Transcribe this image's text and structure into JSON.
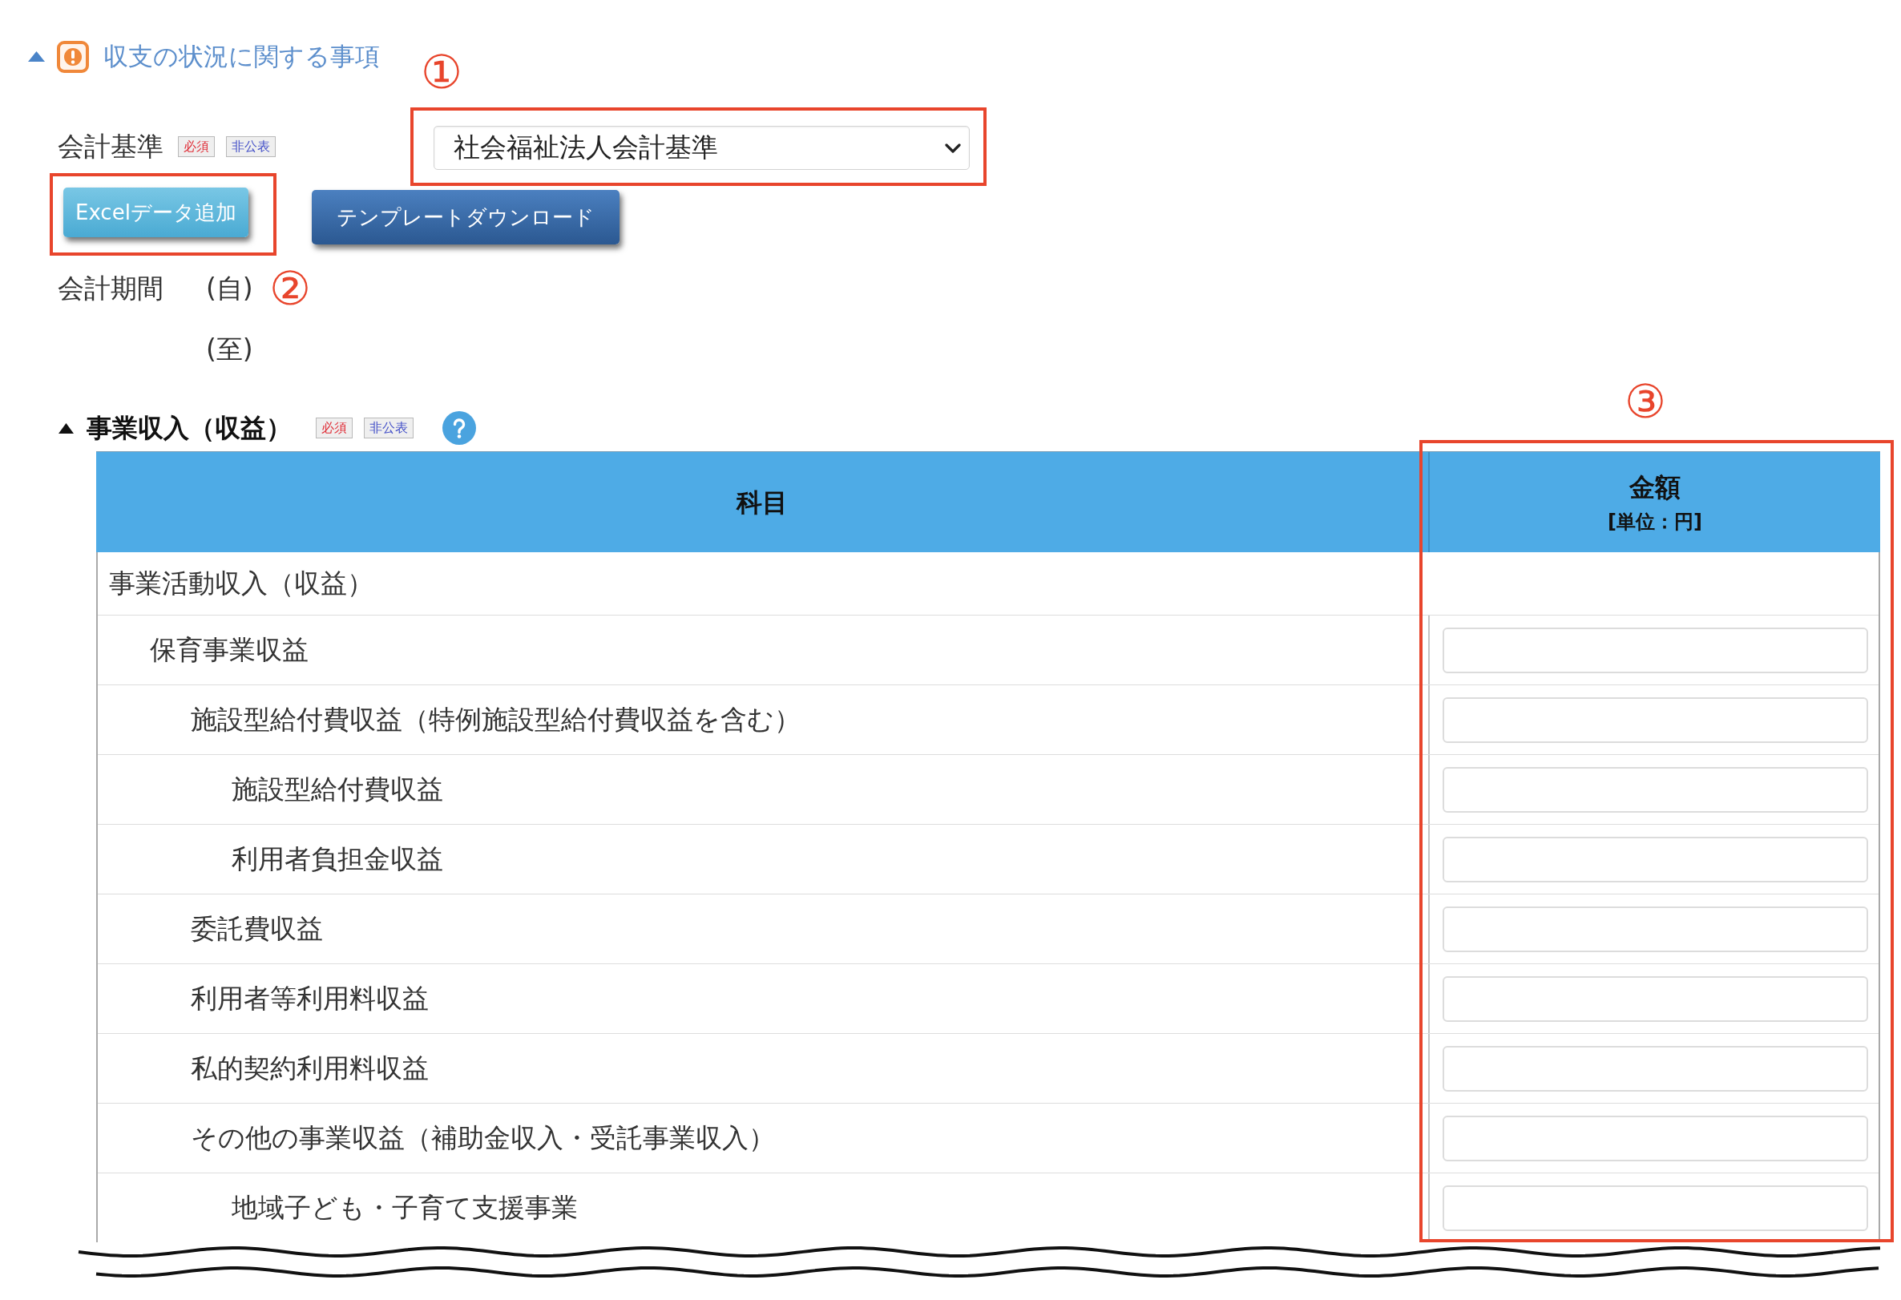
{
  "section": {
    "title": "収支の状況に関する事項",
    "expanded": true
  },
  "accounting_standard": {
    "label": "会計基準",
    "badges": [
      {
        "label": "必須",
        "kind": "required"
      },
      {
        "label": "非公表",
        "kind": "private"
      }
    ],
    "value": "社会福祉法人会計基準",
    "callout": "①"
  },
  "buttons": [
    {
      "label": "Excelデータ追加",
      "kind": "info",
      "callout": "②"
    },
    {
      "label": "テンプレートダウンロード",
      "kind": "primary"
    }
  ],
  "accounting_period": {
    "label": "会計期間",
    "from": "(自)",
    "to": "(至)"
  },
  "subsection": {
    "title": "事業収入（収益）",
    "expanded": true,
    "badges": [
      {
        "label": "必須",
        "kind": "required"
      },
      {
        "label": "非公表",
        "kind": "private"
      }
    ]
  },
  "table": {
    "columns": [
      {
        "label": "科目"
      },
      {
        "label": "金額",
        "unit": "[単位：円]",
        "callout": "③"
      }
    ],
    "rows": [
      {
        "label": "事業活動収入（収益）",
        "kind": "heading",
        "children": [
          {
            "label": "保育事業収益",
            "kind": "amount",
            "children": [
              {
                "label": "施設型給付費収益（特例施設型給付費収益を含む）",
                "kind": "amount",
                "children": [
                  {
                    "label": "施設型給付費収益",
                    "kind": "amount"
                  },
                  {
                    "label": "利用者負担金収益",
                    "kind": "amount"
                  }
                ]
              },
              {
                "label": "委託費収益",
                "kind": "amount"
              },
              {
                "label": "利用者等利用料収益",
                "kind": "amount"
              },
              {
                "label": "私的契約利用料収益",
                "kind": "amount"
              },
              {
                "label": "その他の事業収益（補助金収入・受託事業収入）",
                "kind": "amount",
                "children": [
                  {
                    "label": "地域子ども・子育て支援事業",
                    "kind": "amount"
                  }
                ]
              }
            ]
          }
        ]
      }
    ]
  }
}
